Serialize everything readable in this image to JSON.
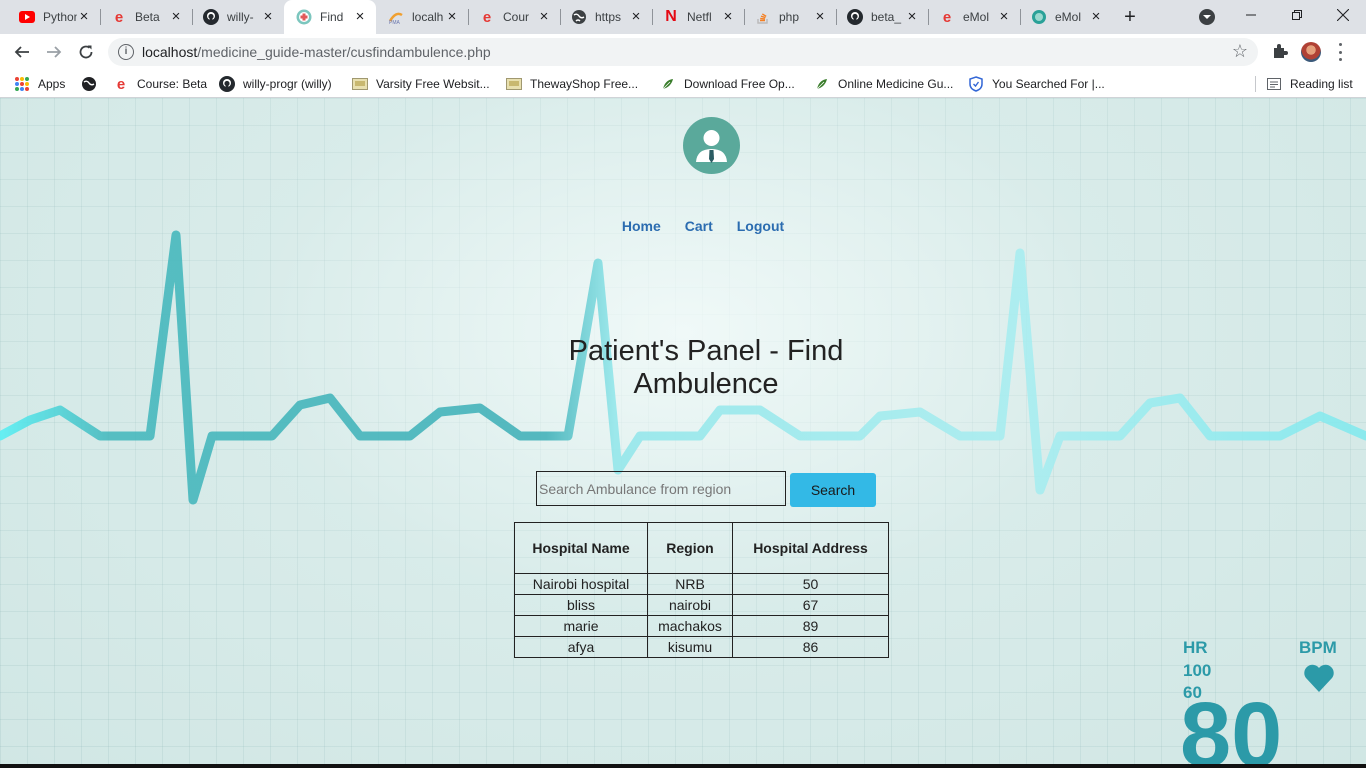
{
  "browser": {
    "tabs": [
      {
        "title": "Python",
        "icon": "youtube-icon",
        "color": "#ff0000"
      },
      {
        "title": "Beta",
        "icon": "e-brand-icon",
        "color": "#e53935"
      },
      {
        "title": "willy-",
        "icon": "github-icon",
        "color": "#24292e"
      },
      {
        "title": "Find",
        "icon": "medical-cross-icon",
        "color": "#e05a5a",
        "active": true
      },
      {
        "title": "localh",
        "icon": "phpmyadmin-icon",
        "color": "#f0a030"
      },
      {
        "title": "Cour",
        "icon": "e-brand-icon",
        "color": "#e53935"
      },
      {
        "title": "https",
        "icon": "globe-icon",
        "color": "#3c4043"
      },
      {
        "title": "Netfl",
        "icon": "netflix-icon",
        "color": "#e50914"
      },
      {
        "title": "php",
        "icon": "stack-overflow-icon",
        "color": "#f48024"
      },
      {
        "title": "beta_",
        "icon": "github-icon",
        "color": "#24292e"
      },
      {
        "title": "eMol",
        "icon": "e-brand-icon",
        "color": "#e53935"
      },
      {
        "title": "eMol",
        "icon": "emol-icon",
        "color": "#2aa198"
      }
    ],
    "address": {
      "host": "localhost",
      "path": "/medicine_guide-master/cusfindambulence.php"
    },
    "bookmarks": [
      {
        "label": "Apps",
        "icon": "apps-grid-icon"
      },
      {
        "label": "",
        "icon": "globe-icon"
      },
      {
        "label": "Course: Beta",
        "icon": "e-brand-icon"
      },
      {
        "label": "willy-progr (willy)",
        "icon": "github-icon"
      },
      {
        "label": "Varsity Free Websit...",
        "icon": "site-thumbnail-icon"
      },
      {
        "label": "ThewayShop Free...",
        "icon": "site-thumbnail-icon"
      },
      {
        "label": "Download Free Op...",
        "icon": "leaf-icon"
      },
      {
        "label": "Online Medicine Gu...",
        "icon": "leaf-icon"
      },
      {
        "label": "You Searched For |...",
        "icon": "shield-icon"
      }
    ],
    "reading_list": "Reading list"
  },
  "page": {
    "nav": [
      "Home",
      "Cart",
      "Logout"
    ],
    "title": "Patient's Panel - Find Ambulence",
    "search": {
      "placeholder": "Search Ambulance from region",
      "value": "",
      "button": "Search"
    },
    "table": {
      "headers": [
        "Hospital Name",
        "Region",
        "Hospital Address"
      ],
      "rows": [
        [
          "Nairobi hospital",
          "NRB",
          "50"
        ],
        [
          "bliss",
          "nairobi",
          "67"
        ],
        [
          "marie",
          "machakos",
          "89"
        ],
        [
          "afya",
          "kisumu",
          "86"
        ]
      ]
    },
    "monitor": {
      "hr": "HR",
      "hr_high": "100",
      "hr_low": "60",
      "bpm": "BPM",
      "reading": "80"
    },
    "colors": {
      "nav_link": "#2b6cb0",
      "button": "#33b9e6",
      "ecg": "#3cb6bd",
      "logo": "#5aa99b"
    }
  }
}
